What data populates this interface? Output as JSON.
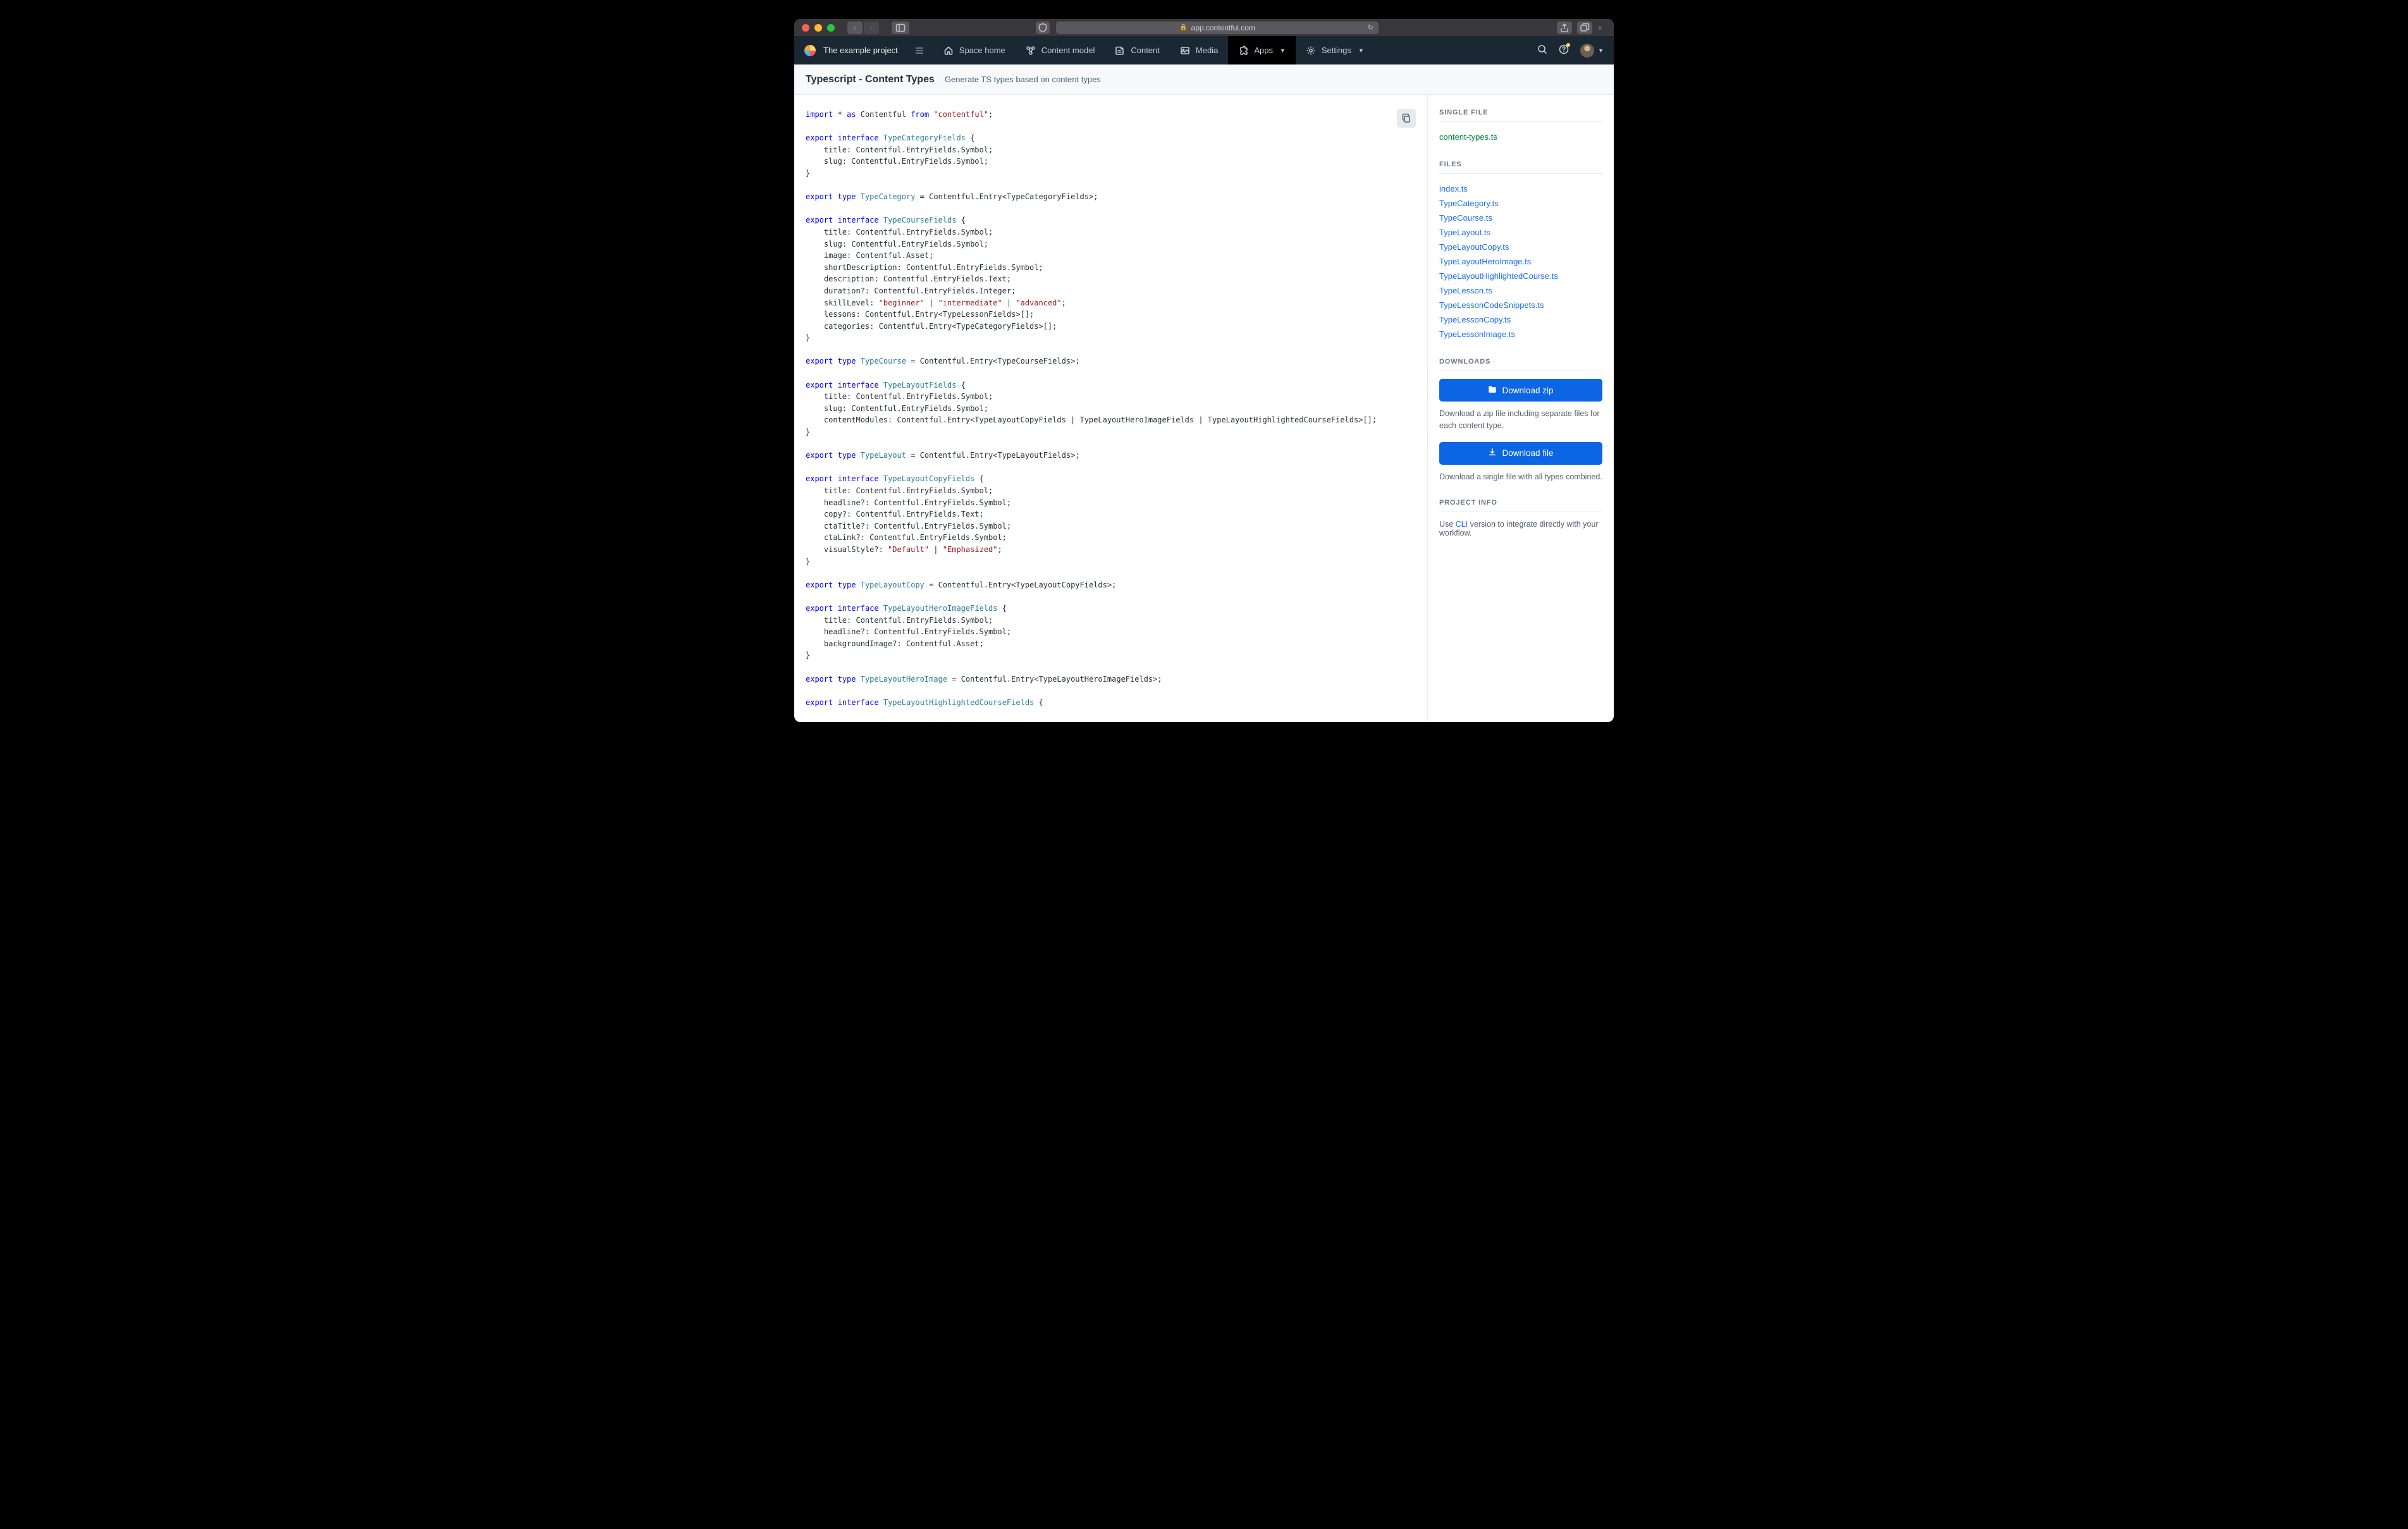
{
  "browser": {
    "url_host": "app.contentful.com"
  },
  "nav": {
    "project": "The example project",
    "items": [
      {
        "label": "Space home"
      },
      {
        "label": "Content model"
      },
      {
        "label": "Content"
      },
      {
        "label": "Media"
      },
      {
        "label": "Apps",
        "active": true,
        "dropdown": true
      },
      {
        "label": "Settings",
        "dropdown": true
      }
    ]
  },
  "header": {
    "title": "Typescript - Content Types",
    "subtitle": "Generate TS types based on content types"
  },
  "code": [
    {
      "t": "key",
      "v": "import"
    },
    {
      "t": "",
      "v": " * "
    },
    {
      "t": "key",
      "v": "as"
    },
    {
      "t": "",
      "v": " Contentful "
    },
    {
      "t": "key",
      "v": "from"
    },
    {
      "t": "",
      "v": " "
    },
    {
      "t": "str",
      "v": "\"contentful\""
    },
    {
      "t": "",
      "v": ";"
    },
    {
      "t": "nl"
    },
    {
      "t": "nl"
    },
    {
      "t": "key",
      "v": "export"
    },
    {
      "t": "",
      "v": " "
    },
    {
      "t": "key",
      "v": "interface"
    },
    {
      "t": "",
      "v": " "
    },
    {
      "t": "type",
      "v": "TypeCategoryFields"
    },
    {
      "t": "",
      "v": " {"
    },
    {
      "t": "nl"
    },
    {
      "t": "",
      "v": "    title: Contentful.EntryFields.Symbol;"
    },
    {
      "t": "nl"
    },
    {
      "t": "",
      "v": "    slug: Contentful.EntryFields.Symbol;"
    },
    {
      "t": "nl"
    },
    {
      "t": "",
      "v": "}"
    },
    {
      "t": "nl"
    },
    {
      "t": "nl"
    },
    {
      "t": "key",
      "v": "export"
    },
    {
      "t": "",
      "v": " "
    },
    {
      "t": "key",
      "v": "type"
    },
    {
      "t": "",
      "v": " "
    },
    {
      "t": "type",
      "v": "TypeCategory"
    },
    {
      "t": "",
      "v": " = Contentful.Entry<TypeCategoryFields>;"
    },
    {
      "t": "nl"
    },
    {
      "t": "nl"
    },
    {
      "t": "key",
      "v": "export"
    },
    {
      "t": "",
      "v": " "
    },
    {
      "t": "key",
      "v": "interface"
    },
    {
      "t": "",
      "v": " "
    },
    {
      "t": "type",
      "v": "TypeCourseFields"
    },
    {
      "t": "",
      "v": " {"
    },
    {
      "t": "nl"
    },
    {
      "t": "",
      "v": "    title: Contentful.EntryFields.Symbol;"
    },
    {
      "t": "nl"
    },
    {
      "t": "",
      "v": "    slug: Contentful.EntryFields.Symbol;"
    },
    {
      "t": "nl"
    },
    {
      "t": "",
      "v": "    image: Contentful.Asset;"
    },
    {
      "t": "nl"
    },
    {
      "t": "",
      "v": "    shortDescription: Contentful.EntryFields.Symbol;"
    },
    {
      "t": "nl"
    },
    {
      "t": "",
      "v": "    description: Contentful.EntryFields.Text;"
    },
    {
      "t": "nl"
    },
    {
      "t": "",
      "v": "    duration?: Contentful.EntryFields.Integer;"
    },
    {
      "t": "nl"
    },
    {
      "t": "",
      "v": "    skillLevel: "
    },
    {
      "t": "str",
      "v": "\"beginner\""
    },
    {
      "t": "",
      "v": " | "
    },
    {
      "t": "str",
      "v": "\"intermediate\""
    },
    {
      "t": "",
      "v": " | "
    },
    {
      "t": "str",
      "v": "\"advanced\""
    },
    {
      "t": "",
      "v": ";"
    },
    {
      "t": "nl"
    },
    {
      "t": "",
      "v": "    lessons: Contentful.Entry<TypeLessonFields>[];"
    },
    {
      "t": "nl"
    },
    {
      "t": "",
      "v": "    categories: Contentful.Entry<TypeCategoryFields>[];"
    },
    {
      "t": "nl"
    },
    {
      "t": "",
      "v": "}"
    },
    {
      "t": "nl"
    },
    {
      "t": "nl"
    },
    {
      "t": "key",
      "v": "export"
    },
    {
      "t": "",
      "v": " "
    },
    {
      "t": "key",
      "v": "type"
    },
    {
      "t": "",
      "v": " "
    },
    {
      "t": "type",
      "v": "TypeCourse"
    },
    {
      "t": "",
      "v": " = Contentful.Entry<TypeCourseFields>;"
    },
    {
      "t": "nl"
    },
    {
      "t": "nl"
    },
    {
      "t": "key",
      "v": "export"
    },
    {
      "t": "",
      "v": " "
    },
    {
      "t": "key",
      "v": "interface"
    },
    {
      "t": "",
      "v": " "
    },
    {
      "t": "type",
      "v": "TypeLayoutFields"
    },
    {
      "t": "",
      "v": " {"
    },
    {
      "t": "nl"
    },
    {
      "t": "",
      "v": "    title: Contentful.EntryFields.Symbol;"
    },
    {
      "t": "nl"
    },
    {
      "t": "",
      "v": "    slug: Contentful.EntryFields.Symbol;"
    },
    {
      "t": "nl"
    },
    {
      "t": "",
      "v": "    contentModules: Contentful.Entry<TypeLayoutCopyFields | TypeLayoutHeroImageFields | TypeLayoutHighlightedCourseFields>[];"
    },
    {
      "t": "nl"
    },
    {
      "t": "",
      "v": "}"
    },
    {
      "t": "nl"
    },
    {
      "t": "nl"
    },
    {
      "t": "key",
      "v": "export"
    },
    {
      "t": "",
      "v": " "
    },
    {
      "t": "key",
      "v": "type"
    },
    {
      "t": "",
      "v": " "
    },
    {
      "t": "type",
      "v": "TypeLayout"
    },
    {
      "t": "",
      "v": " = Contentful.Entry<TypeLayoutFields>;"
    },
    {
      "t": "nl"
    },
    {
      "t": "nl"
    },
    {
      "t": "key",
      "v": "export"
    },
    {
      "t": "",
      "v": " "
    },
    {
      "t": "key",
      "v": "interface"
    },
    {
      "t": "",
      "v": " "
    },
    {
      "t": "type",
      "v": "TypeLayoutCopyFields"
    },
    {
      "t": "",
      "v": " {"
    },
    {
      "t": "nl"
    },
    {
      "t": "",
      "v": "    title: Contentful.EntryFields.Symbol;"
    },
    {
      "t": "nl"
    },
    {
      "t": "",
      "v": "    headline?: Contentful.EntryFields.Symbol;"
    },
    {
      "t": "nl"
    },
    {
      "t": "",
      "v": "    copy?: Contentful.EntryFields.Text;"
    },
    {
      "t": "nl"
    },
    {
      "t": "",
      "v": "    ctaTitle?: Contentful.EntryFields.Symbol;"
    },
    {
      "t": "nl"
    },
    {
      "t": "",
      "v": "    ctaLink?: Contentful.EntryFields.Symbol;"
    },
    {
      "t": "nl"
    },
    {
      "t": "",
      "v": "    visualStyle?: "
    },
    {
      "t": "str",
      "v": "\"Default\""
    },
    {
      "t": "",
      "v": " | "
    },
    {
      "t": "str",
      "v": "\"Emphasized\""
    },
    {
      "t": "",
      "v": ";"
    },
    {
      "t": "nl"
    },
    {
      "t": "",
      "v": "}"
    },
    {
      "t": "nl"
    },
    {
      "t": "nl"
    },
    {
      "t": "key",
      "v": "export"
    },
    {
      "t": "",
      "v": " "
    },
    {
      "t": "key",
      "v": "type"
    },
    {
      "t": "",
      "v": " "
    },
    {
      "t": "type",
      "v": "TypeLayoutCopy"
    },
    {
      "t": "",
      "v": " = Contentful.Entry<TypeLayoutCopyFields>;"
    },
    {
      "t": "nl"
    },
    {
      "t": "nl"
    },
    {
      "t": "key",
      "v": "export"
    },
    {
      "t": "",
      "v": " "
    },
    {
      "t": "key",
      "v": "interface"
    },
    {
      "t": "",
      "v": " "
    },
    {
      "t": "type",
      "v": "TypeLayoutHeroImageFields"
    },
    {
      "t": "",
      "v": " {"
    },
    {
      "t": "nl"
    },
    {
      "t": "",
      "v": "    title: Contentful.EntryFields.Symbol;"
    },
    {
      "t": "nl"
    },
    {
      "t": "",
      "v": "    headline?: Contentful.EntryFields.Symbol;"
    },
    {
      "t": "nl"
    },
    {
      "t": "",
      "v": "    backgroundImage?: Contentful.Asset;"
    },
    {
      "t": "nl"
    },
    {
      "t": "",
      "v": "}"
    },
    {
      "t": "nl"
    },
    {
      "t": "nl"
    },
    {
      "t": "key",
      "v": "export"
    },
    {
      "t": "",
      "v": " "
    },
    {
      "t": "key",
      "v": "type"
    },
    {
      "t": "",
      "v": " "
    },
    {
      "t": "type",
      "v": "TypeLayoutHeroImage"
    },
    {
      "t": "",
      "v": " = Contentful.Entry<TypeLayoutHeroImageFields>;"
    },
    {
      "t": "nl"
    },
    {
      "t": "nl"
    },
    {
      "t": "key",
      "v": "export"
    },
    {
      "t": "",
      "v": " "
    },
    {
      "t": "key",
      "v": "interface"
    },
    {
      "t": "",
      "v": " "
    },
    {
      "t": "type",
      "v": "TypeLayoutHighlightedCourseFields"
    },
    {
      "t": "",
      "v": " {"
    },
    {
      "t": "nl"
    }
  ],
  "sidebar": {
    "single_file_heading": "SINGLE FILE",
    "single_file": "content-types.ts",
    "files_heading": "FILES",
    "files": [
      "index.ts",
      "TypeCategory.ts",
      "TypeCourse.ts",
      "TypeLayout.ts",
      "TypeLayoutCopy.ts",
      "TypeLayoutHeroImage.ts",
      "TypeLayoutHighlightedCourse.ts",
      "TypeLesson.ts",
      "TypeLessonCodeSnippets.ts",
      "TypeLessonCopy.ts",
      "TypeLessonImage.ts"
    ],
    "downloads_heading": "DOWNLOADS",
    "download_zip_label": "Download zip",
    "download_zip_desc": "Download a zip file including separate files for each content type.",
    "download_file_label": "Download file",
    "download_file_desc": "Download a single file with all types combined.",
    "project_info_heading": "PROJECT INFO",
    "project_info_prefix": "Use ",
    "project_info_link": "CLI",
    "project_info_suffix": " version to integrate directly with your workflow."
  }
}
